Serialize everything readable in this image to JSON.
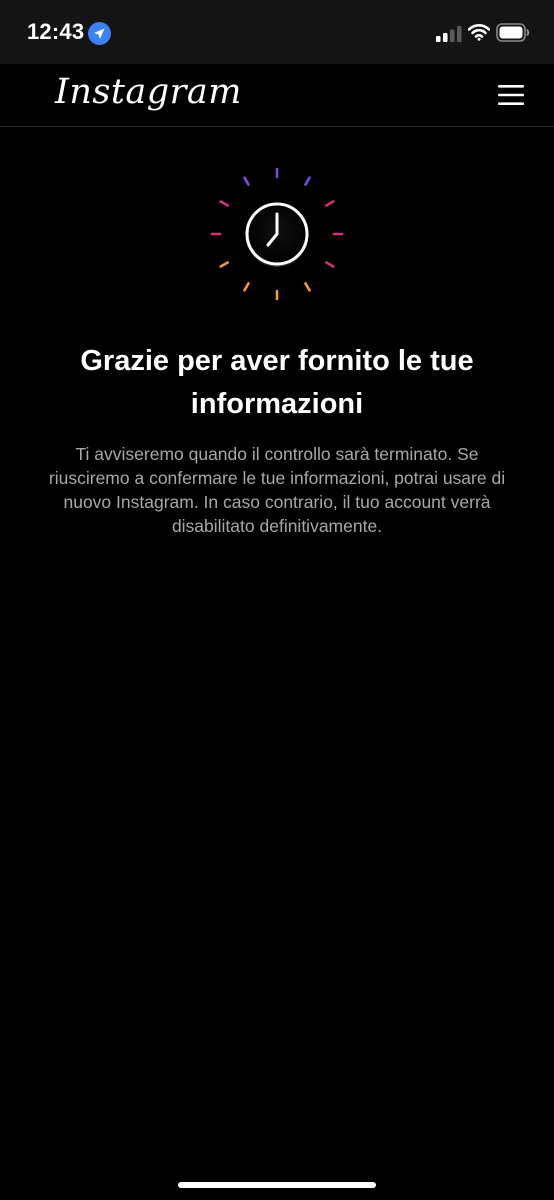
{
  "status_bar": {
    "time": "12:43"
  },
  "header": {
    "logo_text": "Instagram",
    "menu_icon": "hamburger-menu-icon"
  },
  "content": {
    "illustration_icon": "clock-icon",
    "title": "Grazie per aver fornito le tue informazioni",
    "description": "Ti avviseremo quando il controllo sarà terminato. Se riusciremo a confermare le tue informazioni, potrai usare di nuovo Instagram. In caso contrario, il tuo account verrà disabilitato definitivamente."
  },
  "colors": {
    "background": "#000000",
    "status_bar_background": "#141414",
    "text_primary": "#ffffff",
    "text_secondary": "#a8a8a8",
    "location_accent": "#3b82f6",
    "gradient_purple": "#7b4bd8",
    "gradient_pink": "#d6307a",
    "gradient_orange": "#f59a3c"
  }
}
